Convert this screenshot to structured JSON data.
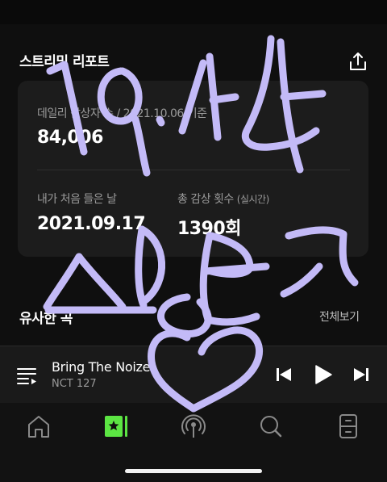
{
  "report": {
    "title": "스트리밍 리포트",
    "daily_listeners_label": "데일리 감상자 수 / 2021.10.06 기준",
    "daily_listeners_value": "84,006",
    "first_listen_label": "내가 처음 들은 날",
    "first_listen_value": "2021.09.17",
    "total_plays_label": "총 감상 횟수",
    "total_plays_note": "(실시간)",
    "total_plays_value": "1390회"
  },
  "similar": {
    "title": "유사한 곡",
    "more_label": "전체보기"
  },
  "player": {
    "track_title": "Bring The Noize",
    "artist": "NCT 127"
  },
  "tabs": [
    {
      "icon": "home-icon"
    },
    {
      "icon": "library-icon",
      "active": true
    },
    {
      "icon": "radio-icon"
    },
    {
      "icon": "search-icon"
    },
    {
      "icon": "storage-icon"
    }
  ],
  "colors": {
    "accent": "#5ce543",
    "scribble": "#c3baf7"
  }
}
